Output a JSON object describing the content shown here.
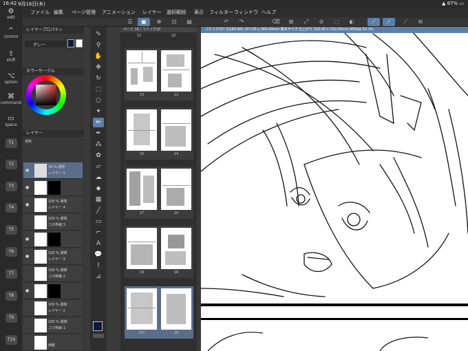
{
  "status": {
    "time": "16:42",
    "date": "9月16日(木)",
    "battery": "87%"
  },
  "menu": [
    "ファイル",
    "編集",
    "ページ管理",
    "アニメーション",
    "レイヤー",
    "選択範囲",
    "表示",
    "フィルター",
    "ウィンドウ",
    "ヘルプ"
  ],
  "side_keys": {
    "edit": "edit",
    "control": "control",
    "shift": "shift",
    "option": "option",
    "command": "command",
    "space": "space",
    "tkeys": [
      "T1",
      "T2",
      "T3",
      "T4",
      "T5",
      "T6",
      "T7",
      "T8",
      "T9",
      "T10"
    ]
  },
  "left_panel": {
    "layer_property_title": "レイヤープロパティ",
    "gray_label": "グレー",
    "color_circle_title": "カラーサークル",
    "layer_title": "レイヤー",
    "blend_mode": "通常",
    "layers": [
      {
        "t1": "19 % 通常",
        "t2": "レイヤー 1"
      },
      {
        "t1": "",
        "t2": ""
      },
      {
        "t1": "100 % 通常",
        "t2": "レイヤー 4"
      },
      {
        "t1": "100 % 通常",
        "t2": "コマ枠線 3"
      },
      {
        "t1": "",
        "t2": ""
      },
      {
        "t1": "100 % 通常",
        "t2": "レイヤー 3"
      },
      {
        "t1": "100 % 通常",
        "t2": "コマ枠線 2"
      },
      {
        "t1": "",
        "t2": ""
      },
      {
        "t1": "100 % 通常",
        "t2": "レイヤー 2"
      },
      {
        "t1": "100 % 通常",
        "t2": "コマ枠線 1"
      },
      {
        "t1": "",
        "t2": "用紙"
      }
    ]
  },
  "page_panel": {
    "tabs": "ページ 18 / コミック10",
    "spreads": [
      {
        "left": "13",
        "right": "12"
      },
      {
        "left": "15",
        "right": "14"
      },
      {
        "left": "17",
        "right": "16"
      },
      {
        "left": "19",
        "right": "18"
      },
      {
        "left": "21*",
        "right": "20"
      }
    ],
    "top_labels": {
      "left": "11",
      "right": "10"
    }
  },
  "canvas": {
    "tab_title": "コミック10* 21(B2:B4) 257.00 x 364.00mm 製本サイズ 仕上がり 220.00 x 310.00mm 600dpi 62.4%"
  },
  "colors": {
    "accent": "#5b7fa6",
    "panel": "#383838",
    "dark": "#2a2a2a"
  }
}
